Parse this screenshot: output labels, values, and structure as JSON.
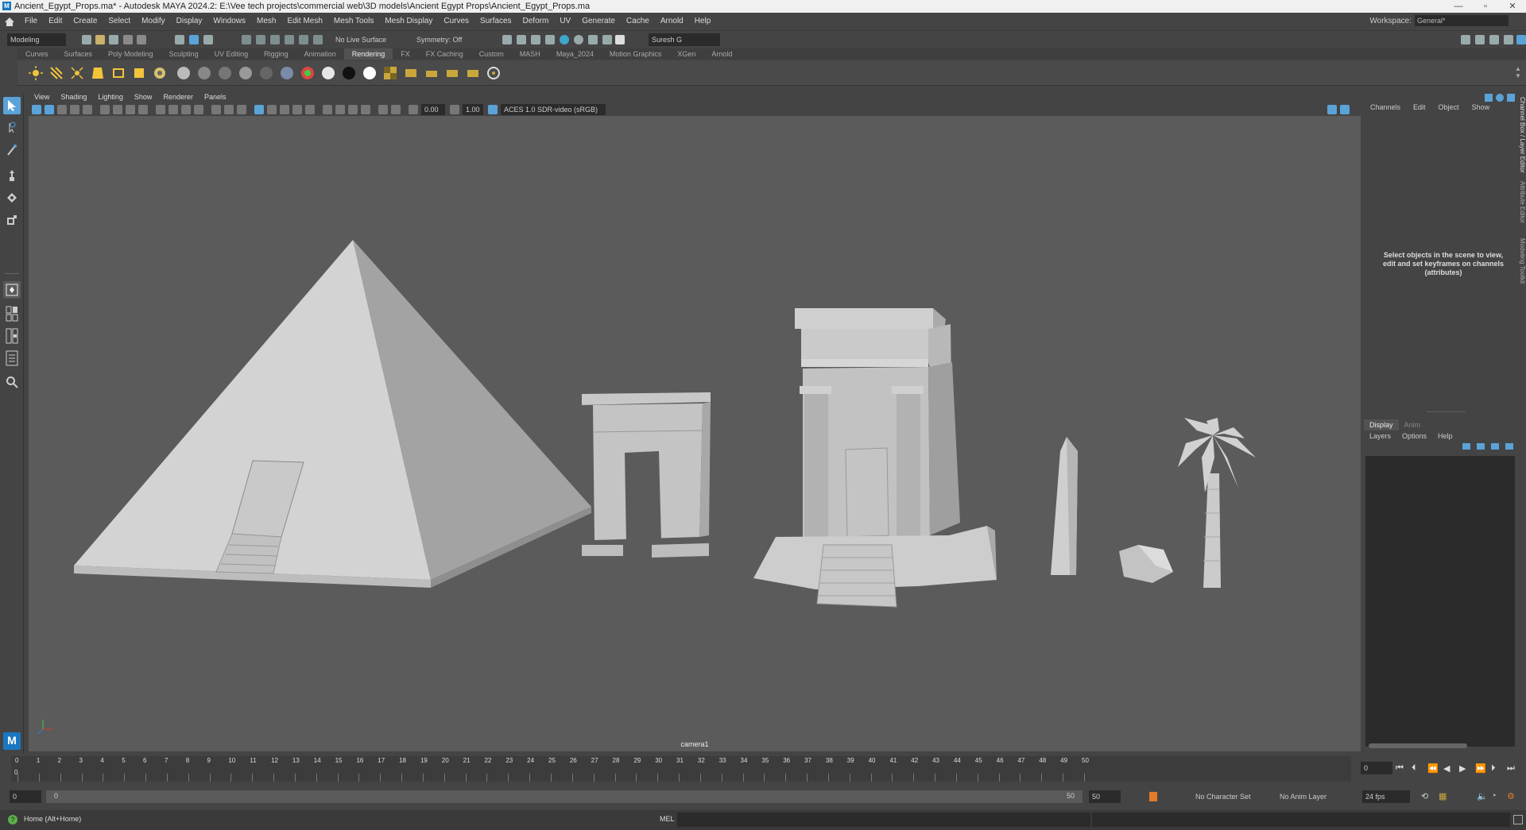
{
  "window": {
    "title": "Ancient_Egypt_Props.ma* - Autodesk MAYA 2024.2: E:\\Vee tech projects\\commercial web\\3D models\\Ancient Egypt Props\\Ancient_Egypt_Props.ma",
    "app_icon": "M",
    "controls": [
      "—",
      "▫",
      "✕"
    ]
  },
  "menus": [
    "File",
    "Edit",
    "Create",
    "Select",
    "Modify",
    "Display",
    "Windows",
    "Mesh",
    "Edit Mesh",
    "Mesh Tools",
    "Mesh Display",
    "Curves",
    "Surfaces",
    "Deform",
    "UV",
    "Generate",
    "Cache",
    "Arnold",
    "Help"
  ],
  "workspace": {
    "label": "Workspace:",
    "value": "General*"
  },
  "statusline": {
    "mode": "Modeling",
    "live_surface": "No Live Surface",
    "symmetry": "Symmetry: Off",
    "user": "Suresh G"
  },
  "shelf_tabs": [
    "Curves",
    "Surfaces",
    "Poly Modeling",
    "Sculpting",
    "UV Editing",
    "Rigging",
    "Animation",
    "Rendering",
    "FX",
    "FX Caching",
    "Custom",
    "MASH",
    "Maya_2024",
    "Motion Graphics",
    "XGen",
    "Arnold"
  ],
  "active_shelf": "Rendering",
  "viewport": {
    "menus": [
      "View",
      "Shading",
      "Lighting",
      "Show",
      "Renderer",
      "Panels"
    ],
    "exposure": "0.00",
    "gamma": "1.00",
    "color_space": "ACES 1.0 SDR-video (sRGB)",
    "camera": "camera1"
  },
  "channel_box": {
    "menus": [
      "Channels",
      "Edit",
      "Object",
      "Show"
    ],
    "message": "Select objects in the scene to view, edit and set keyframes on channels (attributes)"
  },
  "layer_editor": {
    "tabs": [
      "Display",
      "Anim"
    ],
    "menus": [
      "Layers",
      "Options",
      "Help"
    ]
  },
  "side_tabs": [
    "Channel Box / Layer Editor",
    "Attribute Editor",
    "Modeling Toolkit"
  ],
  "timeline": {
    "ticks": [
      0,
      1,
      2,
      3,
      4,
      5,
      6,
      7,
      8,
      9,
      10,
      11,
      12,
      13,
      14,
      15,
      16,
      17,
      18,
      19,
      20,
      21,
      22,
      23,
      24,
      25,
      26,
      27,
      28,
      29,
      30,
      31,
      32,
      33,
      34,
      35,
      36,
      37,
      38,
      39,
      40,
      41,
      42,
      43,
      44,
      45,
      46,
      47,
      48,
      49,
      50
    ],
    "current_frame": "0",
    "current_value": "0"
  },
  "range": {
    "start": "0",
    "inner_start": "0",
    "inner_end": "50",
    "end": "50",
    "character_set": "No Character Set",
    "anim_layer": "No Anim Layer",
    "fps": "24 fps"
  },
  "command": {
    "help_text": "Home (Alt+Home)",
    "mel_label": "MEL"
  }
}
